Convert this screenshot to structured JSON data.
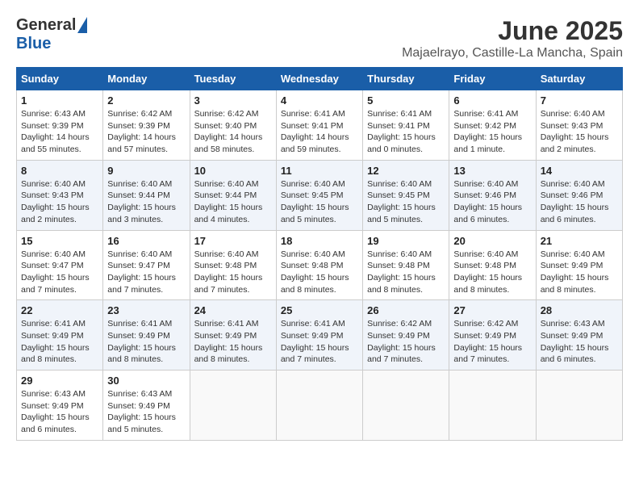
{
  "header": {
    "logo_general": "General",
    "logo_blue": "Blue",
    "month_title": "June 2025",
    "location": "Majaelrayo, Castille-La Mancha, Spain"
  },
  "days_of_week": [
    "Sunday",
    "Monday",
    "Tuesday",
    "Wednesday",
    "Thursday",
    "Friday",
    "Saturday"
  ],
  "weeks": [
    [
      {
        "day": "1",
        "sunrise": "6:43 AM",
        "sunset": "9:39 PM",
        "daylight": "14 hours and 55 minutes."
      },
      {
        "day": "2",
        "sunrise": "6:42 AM",
        "sunset": "9:39 PM",
        "daylight": "14 hours and 57 minutes."
      },
      {
        "day": "3",
        "sunrise": "6:42 AM",
        "sunset": "9:40 PM",
        "daylight": "14 hours and 58 minutes."
      },
      {
        "day": "4",
        "sunrise": "6:41 AM",
        "sunset": "9:41 PM",
        "daylight": "14 hours and 59 minutes."
      },
      {
        "day": "5",
        "sunrise": "6:41 AM",
        "sunset": "9:41 PM",
        "daylight": "15 hours and 0 minutes."
      },
      {
        "day": "6",
        "sunrise": "6:41 AM",
        "sunset": "9:42 PM",
        "daylight": "15 hours and 1 minute."
      },
      {
        "day": "7",
        "sunrise": "6:40 AM",
        "sunset": "9:43 PM",
        "daylight": "15 hours and 2 minutes."
      }
    ],
    [
      {
        "day": "8",
        "sunrise": "6:40 AM",
        "sunset": "9:43 PM",
        "daylight": "15 hours and 2 minutes."
      },
      {
        "day": "9",
        "sunrise": "6:40 AM",
        "sunset": "9:44 PM",
        "daylight": "15 hours and 3 minutes."
      },
      {
        "day": "10",
        "sunrise": "6:40 AM",
        "sunset": "9:44 PM",
        "daylight": "15 hours and 4 minutes."
      },
      {
        "day": "11",
        "sunrise": "6:40 AM",
        "sunset": "9:45 PM",
        "daylight": "15 hours and 5 minutes."
      },
      {
        "day": "12",
        "sunrise": "6:40 AM",
        "sunset": "9:45 PM",
        "daylight": "15 hours and 5 minutes."
      },
      {
        "day": "13",
        "sunrise": "6:40 AM",
        "sunset": "9:46 PM",
        "daylight": "15 hours and 6 minutes."
      },
      {
        "day": "14",
        "sunrise": "6:40 AM",
        "sunset": "9:46 PM",
        "daylight": "15 hours and 6 minutes."
      }
    ],
    [
      {
        "day": "15",
        "sunrise": "6:40 AM",
        "sunset": "9:47 PM",
        "daylight": "15 hours and 7 minutes."
      },
      {
        "day": "16",
        "sunrise": "6:40 AM",
        "sunset": "9:47 PM",
        "daylight": "15 hours and 7 minutes."
      },
      {
        "day": "17",
        "sunrise": "6:40 AM",
        "sunset": "9:48 PM",
        "daylight": "15 hours and 7 minutes."
      },
      {
        "day": "18",
        "sunrise": "6:40 AM",
        "sunset": "9:48 PM",
        "daylight": "15 hours and 8 minutes."
      },
      {
        "day": "19",
        "sunrise": "6:40 AM",
        "sunset": "9:48 PM",
        "daylight": "15 hours and 8 minutes."
      },
      {
        "day": "20",
        "sunrise": "6:40 AM",
        "sunset": "9:48 PM",
        "daylight": "15 hours and 8 minutes."
      },
      {
        "day": "21",
        "sunrise": "6:40 AM",
        "sunset": "9:49 PM",
        "daylight": "15 hours and 8 minutes."
      }
    ],
    [
      {
        "day": "22",
        "sunrise": "6:41 AM",
        "sunset": "9:49 PM",
        "daylight": "15 hours and 8 minutes."
      },
      {
        "day": "23",
        "sunrise": "6:41 AM",
        "sunset": "9:49 PM",
        "daylight": "15 hours and 8 minutes."
      },
      {
        "day": "24",
        "sunrise": "6:41 AM",
        "sunset": "9:49 PM",
        "daylight": "15 hours and 8 minutes."
      },
      {
        "day": "25",
        "sunrise": "6:41 AM",
        "sunset": "9:49 PM",
        "daylight": "15 hours and 7 minutes."
      },
      {
        "day": "26",
        "sunrise": "6:42 AM",
        "sunset": "9:49 PM",
        "daylight": "15 hours and 7 minutes."
      },
      {
        "day": "27",
        "sunrise": "6:42 AM",
        "sunset": "9:49 PM",
        "daylight": "15 hours and 7 minutes."
      },
      {
        "day": "28",
        "sunrise": "6:43 AM",
        "sunset": "9:49 PM",
        "daylight": "15 hours and 6 minutes."
      }
    ],
    [
      {
        "day": "29",
        "sunrise": "6:43 AM",
        "sunset": "9:49 PM",
        "daylight": "15 hours and 6 minutes."
      },
      {
        "day": "30",
        "sunrise": "6:43 AM",
        "sunset": "9:49 PM",
        "daylight": "15 hours and 5 minutes."
      },
      null,
      null,
      null,
      null,
      null
    ]
  ]
}
